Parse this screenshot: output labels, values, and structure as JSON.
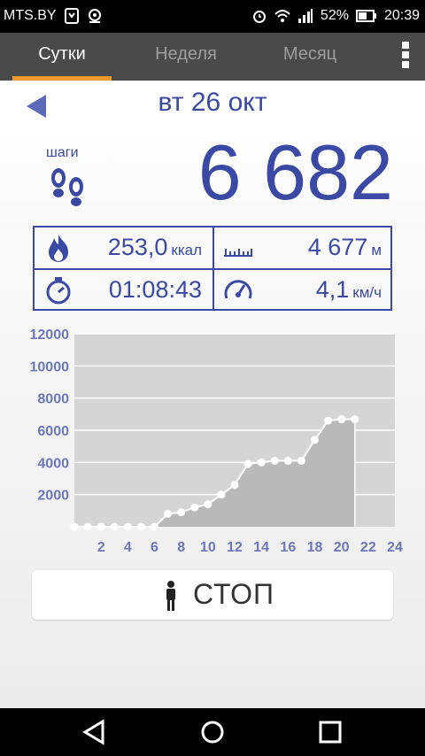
{
  "status_bar": {
    "carrier": "MTS.BY",
    "battery": "52%",
    "time": "20:39"
  },
  "tabs": [
    {
      "label": "Сутки",
      "active": true
    },
    {
      "label": "Неделя",
      "active": false
    },
    {
      "label": "Месяц",
      "active": false
    }
  ],
  "date": "вт 26 окт",
  "steps": {
    "label": "шаги",
    "value": "6 682"
  },
  "stats": {
    "calories": {
      "value": "253,0",
      "unit": "ккал"
    },
    "distance": {
      "value": "4 677",
      "unit": "м"
    },
    "duration": {
      "value": "01:08:43"
    },
    "speed": {
      "value": "4,1",
      "unit": "км/ч"
    }
  },
  "colors": {
    "accent": "#3a49a3",
    "tab_indicator": "#f09a2c",
    "tab_bar": "#4a4a4a",
    "chart_bg": "#d5d5d5",
    "chart_fill": "#b9b9b9",
    "axis_label": "#6b77b8"
  },
  "chart_data": {
    "type": "area",
    "x": [
      0,
      1,
      2,
      3,
      4,
      5,
      6,
      7,
      8,
      9,
      10,
      11,
      12,
      13,
      14,
      15,
      16,
      17,
      18,
      19,
      20,
      21
    ],
    "values": [
      0,
      0,
      0,
      0,
      0,
      0,
      0,
      800,
      900,
      1200,
      1400,
      2000,
      2600,
      3900,
      4000,
      4100,
      4100,
      4100,
      5400,
      6600,
      6682,
      6682
    ],
    "x_ticks": [
      "2",
      "4",
      "6",
      "8",
      "10",
      "12",
      "14",
      "16",
      "18",
      "20",
      "22",
      "24"
    ],
    "y_ticks": [
      "2000",
      "4000",
      "6000",
      "8000",
      "10000",
      "12000"
    ],
    "xlim": [
      0,
      24
    ],
    "ylim": [
      0,
      12000
    ],
    "title": "",
    "xlabel": "",
    "ylabel": "",
    "grid": true
  },
  "stop_button": {
    "label": "СТОП"
  }
}
